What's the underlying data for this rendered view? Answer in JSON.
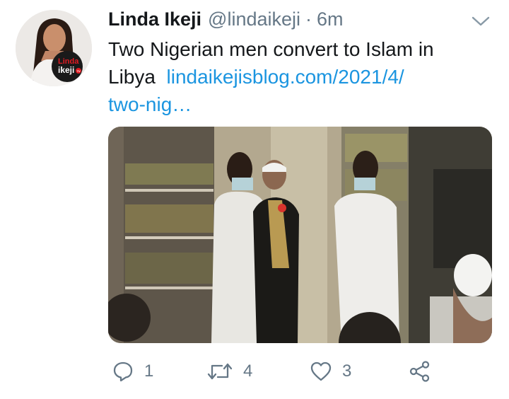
{
  "tweet": {
    "author_name": "Linda Ikeji",
    "handle": "@lindaikeji",
    "separator": "·",
    "time": "6m",
    "text": "Two Nigerian men convert to Islam in Libya",
    "link_line1": "lindaikejisblog.com/2021/4/",
    "link_line2": "two-nig…",
    "avatar_logo": {
      "line1": "Linda",
      "line2": "ikeji",
      "badge": "TV"
    }
  },
  "actions": {
    "reply_count": "1",
    "retweet_count": "4",
    "like_count": "3"
  },
  "icons": {
    "more": "chevron-down-icon",
    "reply": "reply-icon",
    "retweet": "retweet-icon",
    "like": "heart-icon",
    "share": "share-icon"
  },
  "colors": {
    "link": "#1b95e0",
    "secondary_text": "#657786",
    "primary_text": "#14171a"
  }
}
